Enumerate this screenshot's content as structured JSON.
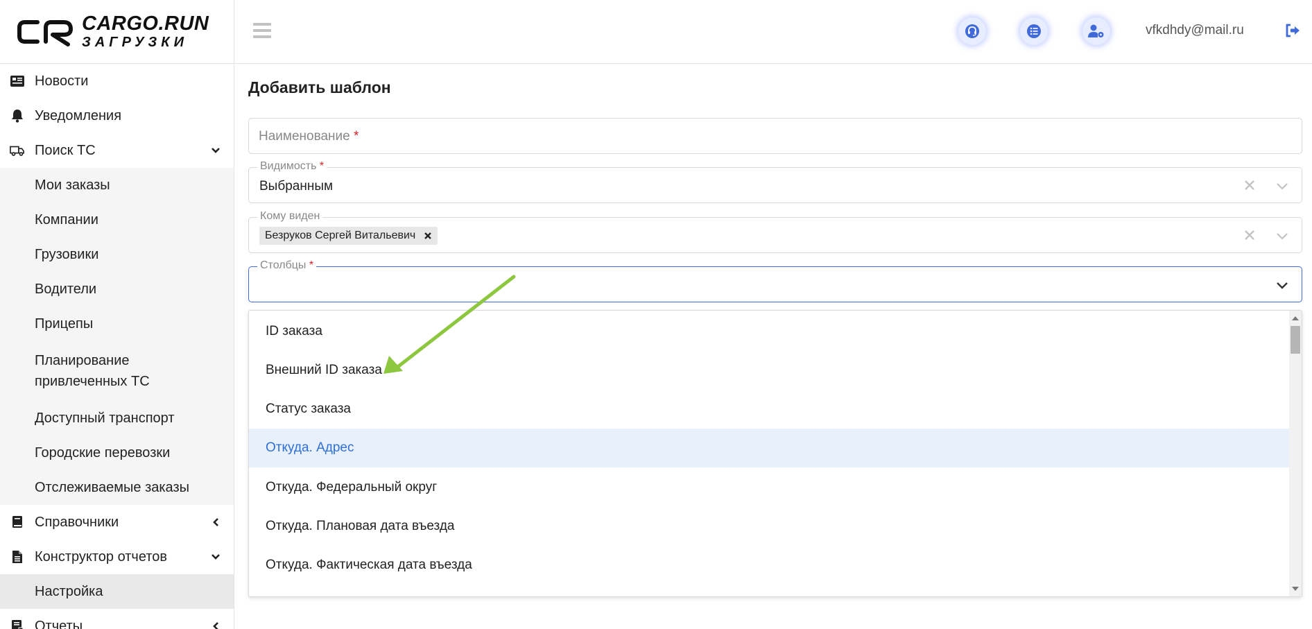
{
  "brand": {
    "line1": "CARGO.RUN",
    "line2": "ЗАГРУЗКИ"
  },
  "sidebar": {
    "items": [
      {
        "label": "Новости",
        "icon": "newspaper-icon"
      },
      {
        "label": "Уведомления",
        "icon": "bell-icon"
      },
      {
        "label": "Поиск ТС",
        "icon": "truck-icon",
        "chevron": "down"
      },
      {
        "label": "Справочники",
        "icon": "book-icon",
        "chevron": "left"
      },
      {
        "label": "Конструктор отчетов",
        "icon": "document-icon",
        "chevron": "down"
      },
      {
        "label": "Отчеты",
        "icon": "report-icon",
        "chevron": "left"
      }
    ],
    "search_sub": [
      "Мои заказы",
      "Компании",
      "Грузовики",
      "Водители",
      "Прицепы",
      "Планирование привлеченных ТС",
      "Доступный транспорт",
      "Городские перевозки",
      "Отслеживаемые заказы"
    ],
    "constructor_sub": [
      "Настройка"
    ]
  },
  "header": {
    "user_email": "vfkdhdy@mail.ru",
    "buttons": [
      "headset-icon",
      "list-icon",
      "user-settings-icon"
    ],
    "accent_color": "#3f6ad8"
  },
  "form": {
    "title": "Добавить шаблон",
    "name_placeholder": "Наименование",
    "required_mark": "*",
    "visibility": {
      "label": "Видимость",
      "value": "Выбранным"
    },
    "visible_to": {
      "label": "Кому виден",
      "tags": [
        "Безруков Сергей Витальевич"
      ]
    },
    "columns": {
      "label": "Столбцы",
      "value": ""
    }
  },
  "dropdown": {
    "options": [
      "ID заказа",
      "Внешний ID заказа",
      "Статус заказа",
      "Откуда. Адрес",
      "Откуда. Федеральный округ",
      "Откуда. Плановая дата въезда",
      "Откуда. Фактическая дата въезда"
    ],
    "highlighted_index": 3,
    "highlight_color": "#2f6fd8"
  },
  "annotation": {
    "arrow_color": "#8dc63f"
  }
}
